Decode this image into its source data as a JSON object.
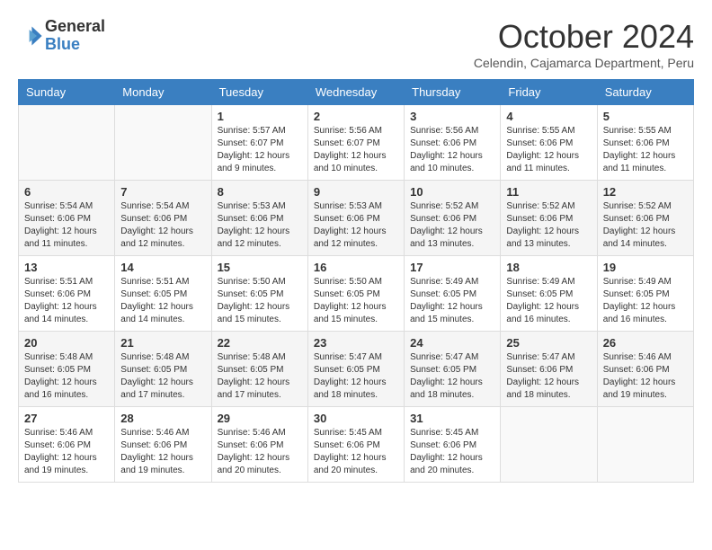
{
  "header": {
    "logo_line1": "General",
    "logo_line2": "Blue",
    "month": "October 2024",
    "location": "Celendin, Cajamarca Department, Peru"
  },
  "weekdays": [
    "Sunday",
    "Monday",
    "Tuesday",
    "Wednesday",
    "Thursday",
    "Friday",
    "Saturday"
  ],
  "weeks": [
    [
      null,
      null,
      {
        "day": 1,
        "sunrise": "5:57 AM",
        "sunset": "6:07 PM",
        "daylight": "12 hours and 9 minutes."
      },
      {
        "day": 2,
        "sunrise": "5:56 AM",
        "sunset": "6:07 PM",
        "daylight": "12 hours and 10 minutes."
      },
      {
        "day": 3,
        "sunrise": "5:56 AM",
        "sunset": "6:06 PM",
        "daylight": "12 hours and 10 minutes."
      },
      {
        "day": 4,
        "sunrise": "5:55 AM",
        "sunset": "6:06 PM",
        "daylight": "12 hours and 11 minutes."
      },
      {
        "day": 5,
        "sunrise": "5:55 AM",
        "sunset": "6:06 PM",
        "daylight": "12 hours and 11 minutes."
      }
    ],
    [
      {
        "day": 6,
        "sunrise": "5:54 AM",
        "sunset": "6:06 PM",
        "daylight": "12 hours and 11 minutes."
      },
      {
        "day": 7,
        "sunrise": "5:54 AM",
        "sunset": "6:06 PM",
        "daylight": "12 hours and 12 minutes."
      },
      {
        "day": 8,
        "sunrise": "5:53 AM",
        "sunset": "6:06 PM",
        "daylight": "12 hours and 12 minutes."
      },
      {
        "day": 9,
        "sunrise": "5:53 AM",
        "sunset": "6:06 PM",
        "daylight": "12 hours and 12 minutes."
      },
      {
        "day": 10,
        "sunrise": "5:52 AM",
        "sunset": "6:06 PM",
        "daylight": "12 hours and 13 minutes."
      },
      {
        "day": 11,
        "sunrise": "5:52 AM",
        "sunset": "6:06 PM",
        "daylight": "12 hours and 13 minutes."
      },
      {
        "day": 12,
        "sunrise": "5:52 AM",
        "sunset": "6:06 PM",
        "daylight": "12 hours and 14 minutes."
      }
    ],
    [
      {
        "day": 13,
        "sunrise": "5:51 AM",
        "sunset": "6:06 PM",
        "daylight": "12 hours and 14 minutes."
      },
      {
        "day": 14,
        "sunrise": "5:51 AM",
        "sunset": "6:05 PM",
        "daylight": "12 hours and 14 minutes."
      },
      {
        "day": 15,
        "sunrise": "5:50 AM",
        "sunset": "6:05 PM",
        "daylight": "12 hours and 15 minutes."
      },
      {
        "day": 16,
        "sunrise": "5:50 AM",
        "sunset": "6:05 PM",
        "daylight": "12 hours and 15 minutes."
      },
      {
        "day": 17,
        "sunrise": "5:49 AM",
        "sunset": "6:05 PM",
        "daylight": "12 hours and 15 minutes."
      },
      {
        "day": 18,
        "sunrise": "5:49 AM",
        "sunset": "6:05 PM",
        "daylight": "12 hours and 16 minutes."
      },
      {
        "day": 19,
        "sunrise": "5:49 AM",
        "sunset": "6:05 PM",
        "daylight": "12 hours and 16 minutes."
      }
    ],
    [
      {
        "day": 20,
        "sunrise": "5:48 AM",
        "sunset": "6:05 PM",
        "daylight": "12 hours and 16 minutes."
      },
      {
        "day": 21,
        "sunrise": "5:48 AM",
        "sunset": "6:05 PM",
        "daylight": "12 hours and 17 minutes."
      },
      {
        "day": 22,
        "sunrise": "5:48 AM",
        "sunset": "6:05 PM",
        "daylight": "12 hours and 17 minutes."
      },
      {
        "day": 23,
        "sunrise": "5:47 AM",
        "sunset": "6:05 PM",
        "daylight": "12 hours and 18 minutes."
      },
      {
        "day": 24,
        "sunrise": "5:47 AM",
        "sunset": "6:05 PM",
        "daylight": "12 hours and 18 minutes."
      },
      {
        "day": 25,
        "sunrise": "5:47 AM",
        "sunset": "6:06 PM",
        "daylight": "12 hours and 18 minutes."
      },
      {
        "day": 26,
        "sunrise": "5:46 AM",
        "sunset": "6:06 PM",
        "daylight": "12 hours and 19 minutes."
      }
    ],
    [
      {
        "day": 27,
        "sunrise": "5:46 AM",
        "sunset": "6:06 PM",
        "daylight": "12 hours and 19 minutes."
      },
      {
        "day": 28,
        "sunrise": "5:46 AM",
        "sunset": "6:06 PM",
        "daylight": "12 hours and 19 minutes."
      },
      {
        "day": 29,
        "sunrise": "5:46 AM",
        "sunset": "6:06 PM",
        "daylight": "12 hours and 20 minutes."
      },
      {
        "day": 30,
        "sunrise": "5:45 AM",
        "sunset": "6:06 PM",
        "daylight": "12 hours and 20 minutes."
      },
      {
        "day": 31,
        "sunrise": "5:45 AM",
        "sunset": "6:06 PM",
        "daylight": "12 hours and 20 minutes."
      },
      null,
      null
    ]
  ]
}
